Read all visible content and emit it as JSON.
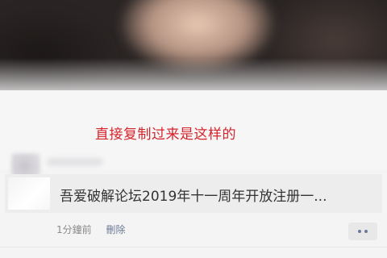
{
  "annotation": {
    "text": "直接复制过来是这样的",
    "color": "#d6242c"
  },
  "post": {
    "shared_link": {
      "title": "吾爱破解论坛2019年十一周年开放注册一..."
    },
    "meta": {
      "time": "1分鐘前",
      "delete_label": "刪除"
    },
    "more_icon": "more-dots-icon"
  },
  "colors": {
    "background": "#f4f4f4",
    "link_blue": "#6b7a96",
    "meta_gray": "#8a8a8a"
  }
}
